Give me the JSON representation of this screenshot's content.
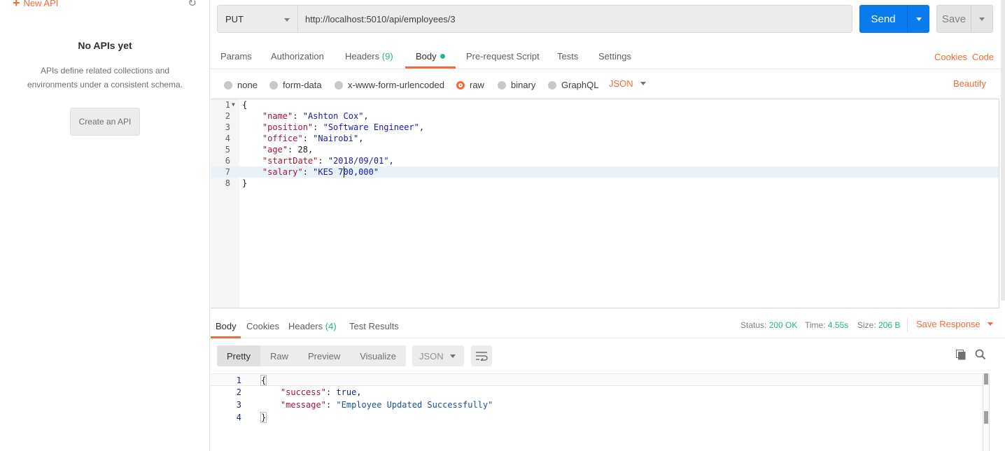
{
  "sidebar": {
    "new_api": "New API",
    "empty_title": "No APIs yet",
    "empty_desc": "APIs define related collections and environments under a consistent schema.",
    "create_button": "Create an API"
  },
  "request": {
    "method": "PUT",
    "url": "http://localhost:5010/api/employees/3",
    "send_label": "Send",
    "save_label": "Save"
  },
  "req_tabs": {
    "params": "Params",
    "authorization": "Authorization",
    "headers": "Headers",
    "headers_count": "(9)",
    "body": "Body",
    "prerequest": "Pre-request Script",
    "tests": "Tests",
    "settings": "Settings",
    "cookies": "Cookies",
    "code": "Code"
  },
  "body_types": {
    "none": "none",
    "form_data": "form-data",
    "urlencoded": "x-www-form-urlencoded",
    "raw": "raw",
    "binary": "binary",
    "graphql": "GraphQL",
    "format": "JSON",
    "beautify": "Beautify",
    "selected": "raw"
  },
  "request_body": {
    "line_numbers": [
      "1",
      "2",
      "3",
      "4",
      "5",
      "6",
      "7",
      "8"
    ],
    "open": "{",
    "close": "}",
    "fields": [
      {
        "key": "\"name\"",
        "value": "\"Ashton Cox\"",
        "sep": ","
      },
      {
        "key": "\"position\"",
        "value": "\"Software Engineer\"",
        "sep": ","
      },
      {
        "key": "\"office\"",
        "value": "\"Nairobi\"",
        "sep": ","
      },
      {
        "key": "\"age\"",
        "value": "28",
        "sep": ","
      },
      {
        "key": "\"startDate\"",
        "value": "\"2018/09/01\"",
        "sep": ","
      },
      {
        "key": "\"salary\"",
        "value": "\"KES 700,000\"",
        "sep": ""
      }
    ]
  },
  "response": {
    "tabs": {
      "body": "Body",
      "cookies": "Cookies",
      "headers": "Headers",
      "headers_count": "(4)",
      "test_results": "Test Results"
    },
    "status_label": "Status:",
    "status_value": "200 OK",
    "time_label": "Time:",
    "time_value": "4.55s",
    "size_label": "Size:",
    "size_value": "206 B",
    "save_response": "Save Response",
    "views": {
      "pretty": "Pretty",
      "raw": "Raw",
      "preview": "Preview",
      "visualize": "Visualize"
    },
    "format": "JSON",
    "line_numbers": [
      "1",
      "2",
      "3",
      "4"
    ],
    "open": "{",
    "close": "}",
    "fields": [
      {
        "key": "\"success\"",
        "value": "true",
        "sep": ","
      },
      {
        "key": "\"message\"",
        "value": "\"Employee Updated Successfully\"",
        "sep": ""
      }
    ]
  },
  "colors": {
    "accent": "#f26b3a",
    "send": "#097bed",
    "success": "#26b47f"
  }
}
